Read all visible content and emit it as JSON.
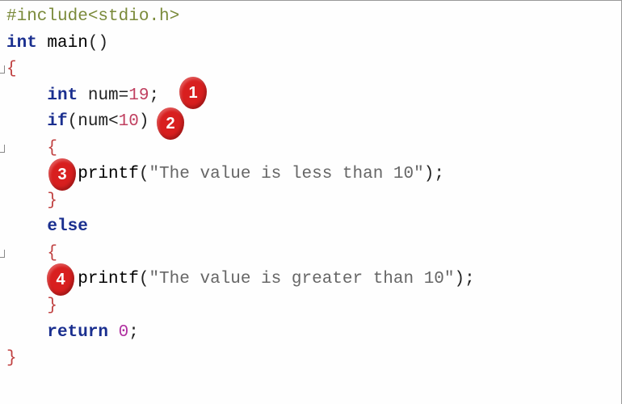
{
  "code": {
    "line1": {
      "preproc": "#include",
      "header": "<stdio.h>"
    },
    "line2": {
      "kw_int": "int",
      "main": "main",
      "parens": "()"
    },
    "line3": {
      "brace": "{"
    },
    "line4": {
      "kw_int": "int",
      "ident": "num",
      "eq": "=",
      "num": "19",
      "semi": ";"
    },
    "line5": {
      "kw_if": "if",
      "lp": "(",
      "ident": "num",
      "lt": "<",
      "num": "10",
      "rp": ")"
    },
    "line6": {
      "brace": "{"
    },
    "line7": {
      "fn": "printf",
      "lp": "(",
      "str": "\"The value is less than 10\"",
      "rp": ")",
      "semi": ";"
    },
    "line8": {
      "brace": "}"
    },
    "line9": {
      "kw_else": "else"
    },
    "line10": {
      "brace": "{"
    },
    "line11": {
      "fn": "printf",
      "lp": "(",
      "str": "\"The value is greater than 10\"",
      "rp": ")",
      "semi": ";"
    },
    "line12": {
      "brace": "}"
    },
    "line13": {
      "kw_return": "return",
      "val": "0",
      "semi": ";"
    },
    "line14": {
      "brace": "}"
    }
  },
  "callouts": {
    "c1": "1",
    "c2": "2",
    "c3": "3",
    "c4": "4"
  }
}
